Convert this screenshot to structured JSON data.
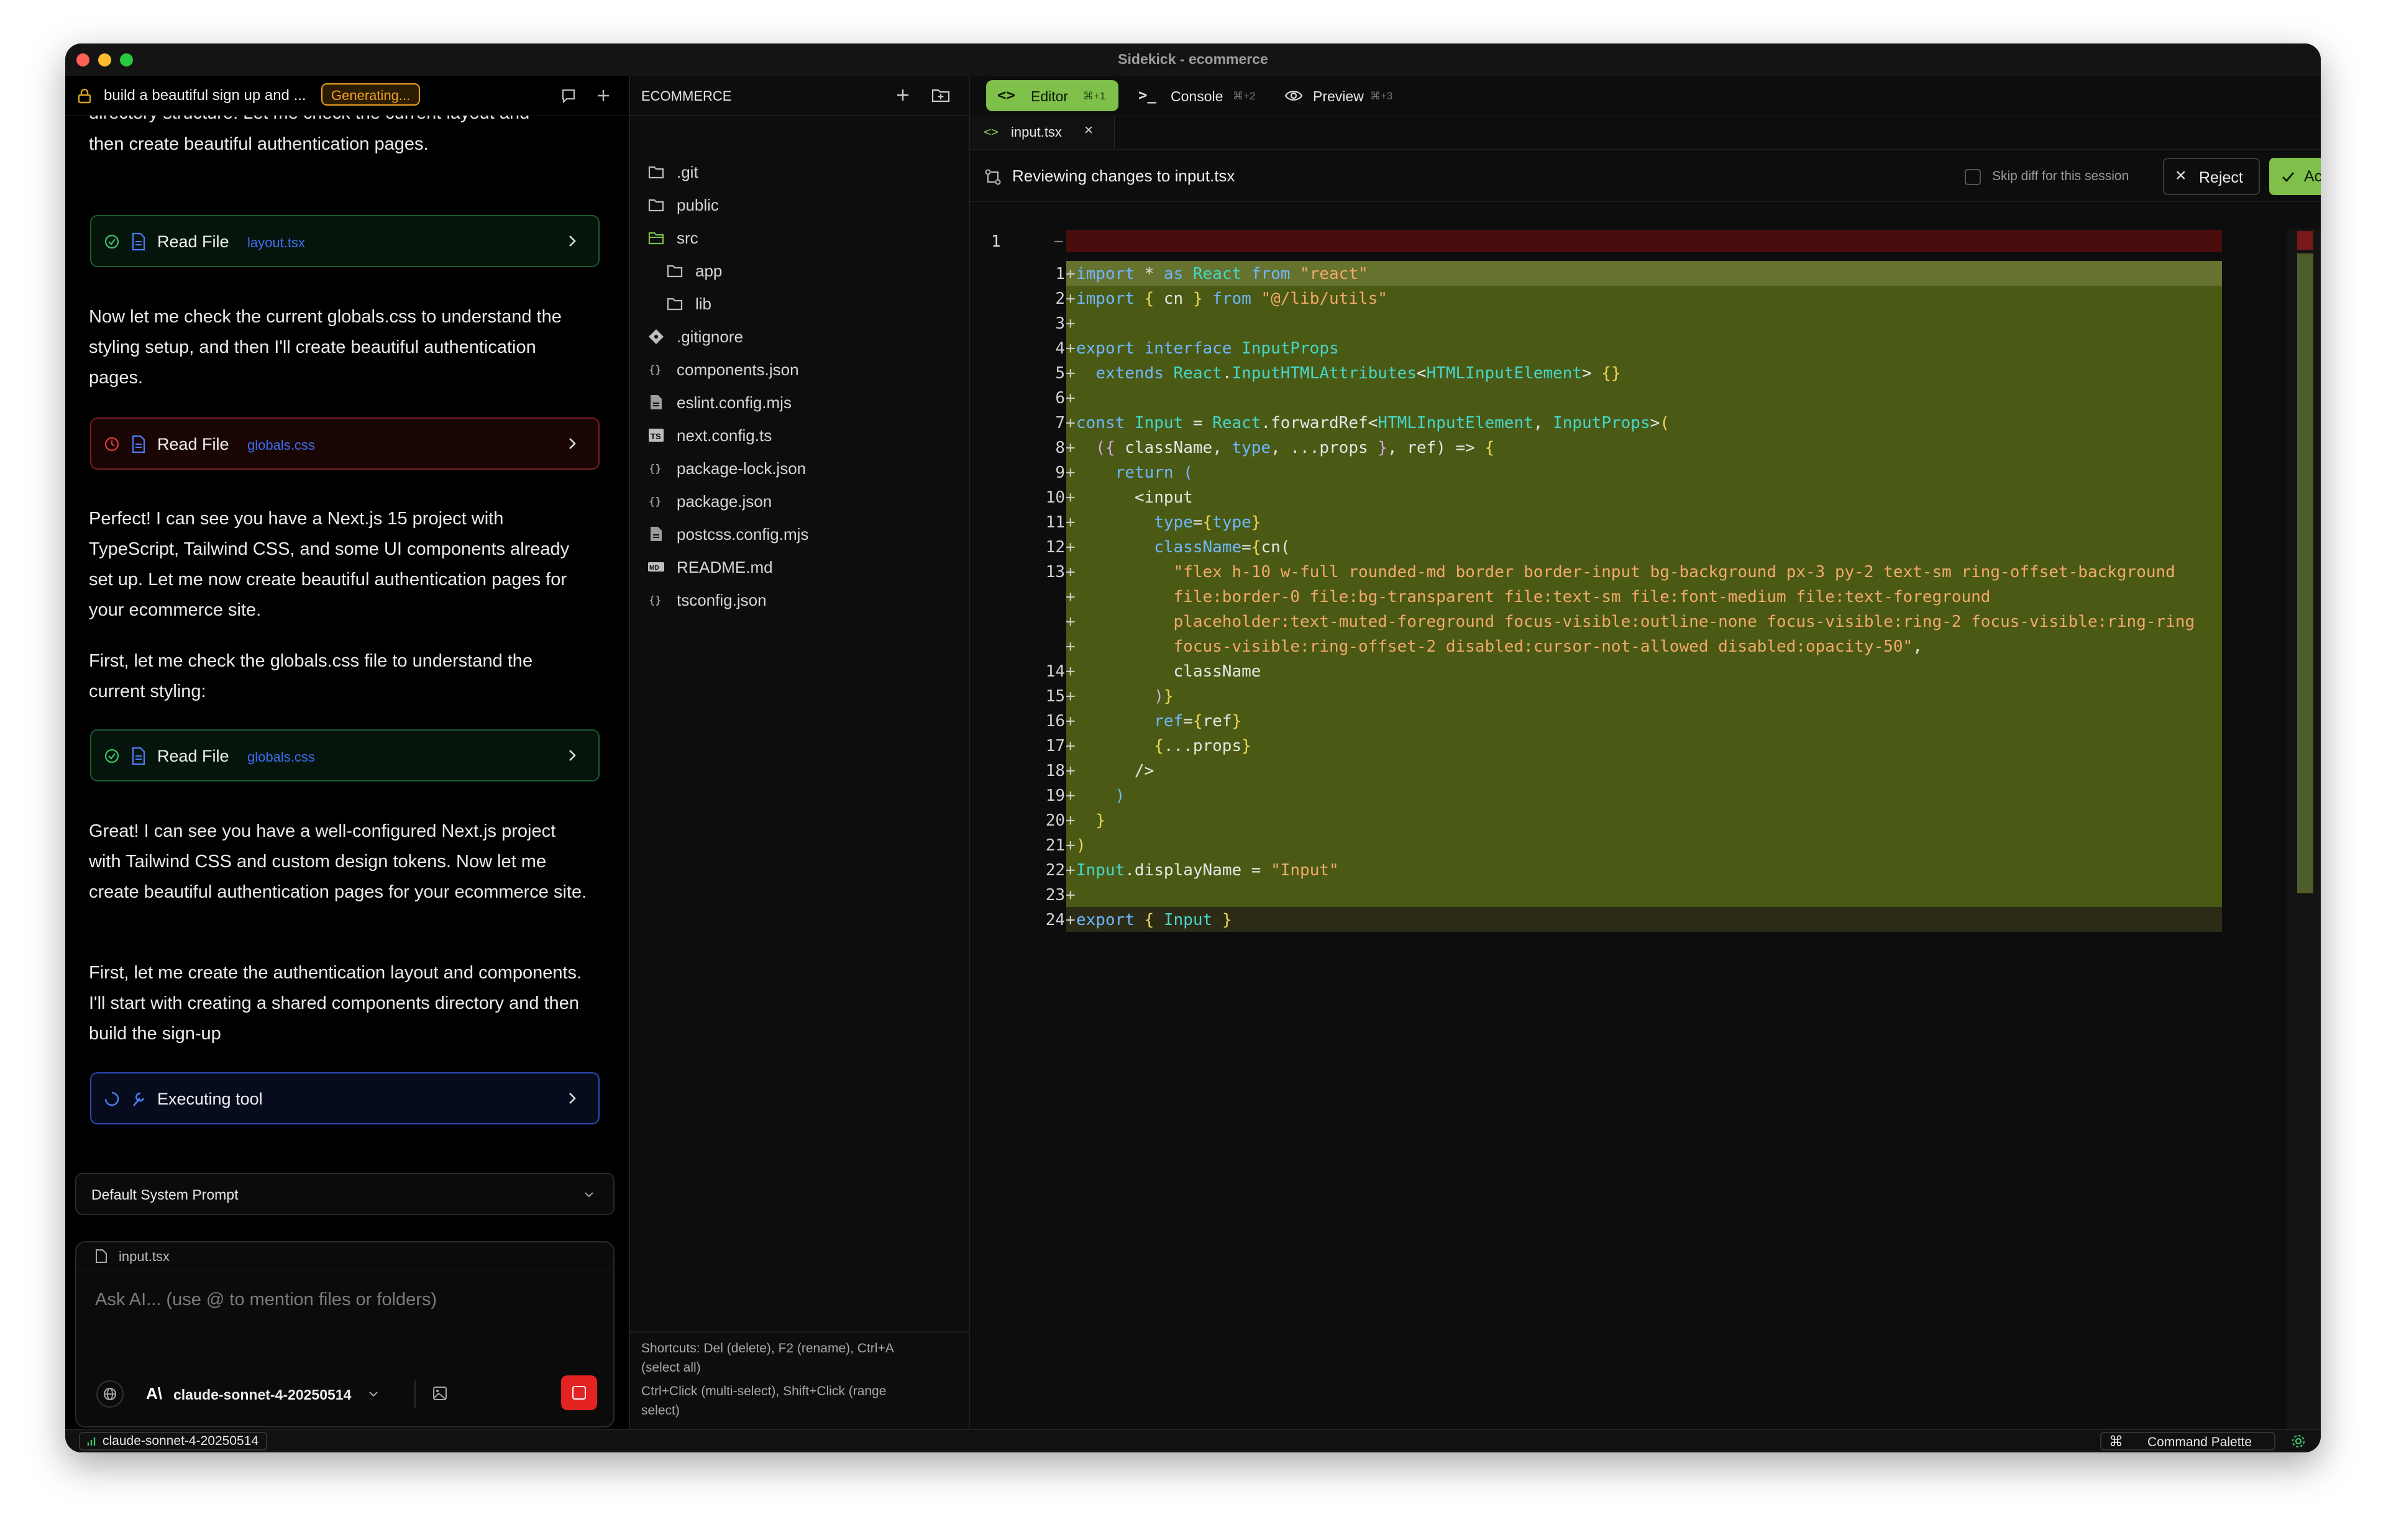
{
  "window": {
    "title": "Sidekick - ecommerce"
  },
  "chat": {
    "thread_title": "build a beautiful sign up and ...",
    "status_badge": "Generating...",
    "cut_off_text": "directory structure. Let me check the current layout and",
    "messages": [
      {
        "text": "then create beautiful authentication pages."
      },
      {
        "text": "Now let me check the current globals.css to understand the styling setup, and then I'll create beautiful authentication pages."
      },
      {
        "text": "Perfect! I can see you have a Next.js 15 project with TypeScript, Tailwind CSS, and some UI components already set up. Let me now create beautiful authentication pages for your ecommerce site."
      },
      {
        "text": "First, let me check the globals.css file to understand the current styling:"
      },
      {
        "text": "Great! I can see you have a well-configured Next.js project with Tailwind CSS and custom design tokens. Now let me create beautiful authentication pages for your ecommerce site."
      },
      {
        "text": "First, let me create the authentication layout and components. I'll start with creating a shared components directory and then build the sign-up"
      }
    ],
    "tools": [
      {
        "label": "Read File",
        "file": "layout.tsx",
        "status": "success"
      },
      {
        "label": "Read File",
        "file": "globals.css",
        "status": "error"
      },
      {
        "label": "Read File",
        "file": "globals.css",
        "status": "success"
      },
      {
        "label": "Executing tool",
        "file": "",
        "status": "running"
      }
    ],
    "system_prompt": "Default System Prompt",
    "context_file": "input.tsx",
    "input_placeholder": "Ask AI... (use @ to mention files or folders)",
    "model": "claude-sonnet-4-20250514"
  },
  "explorer": {
    "title": "ECOMMERCE",
    "items": [
      {
        "name": ".git",
        "icon": "folder-icon",
        "depth": 0
      },
      {
        "name": "public",
        "icon": "folder-icon",
        "depth": 0
      },
      {
        "name": "src",
        "icon": "folder-open-icon",
        "depth": 0
      },
      {
        "name": "app",
        "icon": "folder-icon",
        "depth": 1
      },
      {
        "name": "lib",
        "icon": "folder-icon",
        "depth": 1
      },
      {
        "name": ".gitignore",
        "icon": "git-icon",
        "depth": 0
      },
      {
        "name": "components.json",
        "icon": "json-icon",
        "depth": 0
      },
      {
        "name": "eslint.config.mjs",
        "icon": "file-icon",
        "depth": 0
      },
      {
        "name": "next.config.ts",
        "icon": "ts-icon",
        "depth": 0
      },
      {
        "name": "package-lock.json",
        "icon": "json-icon",
        "depth": 0
      },
      {
        "name": "package.json",
        "icon": "json-icon",
        "depth": 0
      },
      {
        "name": "postcss.config.mjs",
        "icon": "file-icon",
        "depth": 0
      },
      {
        "name": "README.md",
        "icon": "markdown-icon",
        "depth": 0
      },
      {
        "name": "tsconfig.json",
        "icon": "json-icon",
        "depth": 0
      }
    ],
    "shortcuts_1": "Shortcuts: Del (delete), F2 (rename), Ctrl+A",
    "shortcuts_2": "(select all)",
    "shortcuts_3": "Ctrl+Click (multi-select), Shift+Click (range",
    "shortcuts_4": "select)"
  },
  "editor": {
    "tabs": [
      {
        "label": "Editor",
        "shortcut": "⌘+1"
      },
      {
        "label": "Console",
        "shortcut": "⌘+2"
      },
      {
        "label": "Preview",
        "shortcut": "⌘+3"
      }
    ],
    "file_tab": "input.tsx",
    "review_text": "Reviewing changes to input.tsx",
    "skip_label": "Skip diff for this session",
    "reject_label": "Reject",
    "accept_label": "Accept",
    "removed_line": {
      "num": "1",
      "marker": "−"
    },
    "lines": [
      {
        "n": "1",
        "segs": [
          [
            "k",
            "import"
          ],
          [
            "f",
            " * "
          ],
          [
            "k",
            "as"
          ],
          [
            "t",
            " React "
          ],
          [
            "k",
            "from"
          ],
          [
            "s",
            " \"react\""
          ]
        ]
      },
      {
        "n": "2",
        "segs": [
          [
            "k",
            "import"
          ],
          [
            "y",
            " { "
          ],
          [
            "f",
            "cn"
          ],
          [
            "y",
            " } "
          ],
          [
            "k",
            "from"
          ],
          [
            "s",
            " \"@/lib/utils\""
          ]
        ]
      },
      {
        "n": "3",
        "segs": []
      },
      {
        "n": "4",
        "segs": [
          [
            "k",
            "export interface "
          ],
          [
            "t",
            "InputProps"
          ]
        ]
      },
      {
        "n": "5",
        "segs": [
          [
            "f",
            "  "
          ],
          [
            "k",
            "extends "
          ],
          [
            "t",
            "React"
          ],
          [
            "f",
            "."
          ],
          [
            "t",
            "InputHTMLAttributes"
          ],
          [
            "f",
            "<"
          ],
          [
            "t",
            "HTMLInputElement"
          ],
          [
            "f",
            "> "
          ],
          [
            "y",
            "{}"
          ]
        ]
      },
      {
        "n": "6",
        "segs": []
      },
      {
        "n": "7",
        "segs": [
          [
            "k",
            "const "
          ],
          [
            "t",
            "Input"
          ],
          [
            "f",
            " = "
          ],
          [
            "t",
            "React"
          ],
          [
            "f",
            ".forwardRef<"
          ],
          [
            "t",
            "HTMLInputElement"
          ],
          [
            "f",
            ", "
          ],
          [
            "t",
            "InputProps"
          ],
          [
            "f",
            ">"
          ],
          [
            "y",
            "("
          ]
        ]
      },
      {
        "n": "8",
        "segs": [
          [
            "p",
            "  ({ "
          ],
          [
            "f",
            "className, "
          ],
          [
            "k",
            "type"
          ],
          [
            "f",
            ", ...props "
          ],
          [
            "p",
            "}"
          ],
          [
            "f",
            ", ref) => "
          ],
          [
            "y",
            "{"
          ]
        ]
      },
      {
        "n": "9",
        "segs": [
          [
            "f",
            "    "
          ],
          [
            "k",
            "return ("
          ]
        ]
      },
      {
        "n": "10",
        "segs": [
          [
            "f",
            "      <input"
          ]
        ]
      },
      {
        "n": "11",
        "segs": [
          [
            "f",
            "        "
          ],
          [
            "k",
            "type"
          ],
          [
            "f",
            "="
          ],
          [
            "y",
            "{"
          ],
          [
            "k",
            "type"
          ],
          [
            "y",
            "}"
          ]
        ]
      },
      {
        "n": "12",
        "segs": [
          [
            "f",
            "        "
          ],
          [
            "k",
            "className"
          ],
          [
            "f",
            "="
          ],
          [
            "y",
            "{"
          ],
          [
            "f",
            "cn("
          ]
        ]
      },
      {
        "n": "13",
        "segs": [
          [
            "s",
            "          \"flex h-10 w-full rounded-md border border-input bg-background px-3 py-2 text-sm ring-offset-background"
          ]
        ]
      },
      {
        "n": "",
        "segs": [
          [
            "s",
            "          file:border-0 file:bg-transparent file:text-sm file:font-medium file:text-foreground"
          ]
        ]
      },
      {
        "n": "",
        "segs": [
          [
            "s",
            "          placeholder:text-muted-foreground focus-visible:outline-none focus-visible:ring-2 focus-visible:ring-ring"
          ]
        ]
      },
      {
        "n": "",
        "segs": [
          [
            "s",
            "          focus-visible:ring-offset-2 disabled:cursor-not-allowed disabled:opacity-50\""
          ],
          [
            "f",
            ","
          ]
        ]
      },
      {
        "n": "14",
        "segs": [
          [
            "f",
            "          className"
          ]
        ]
      },
      {
        "n": "15",
        "segs": [
          [
            "f",
            "        "
          ],
          [
            "p",
            ")"
          ],
          [
            "y",
            "}"
          ]
        ]
      },
      {
        "n": "16",
        "segs": [
          [
            "f",
            "        "
          ],
          [
            "k",
            "ref"
          ],
          [
            "f",
            "="
          ],
          [
            "y",
            "{"
          ],
          [
            "f",
            "ref"
          ],
          [
            "y",
            "}"
          ]
        ]
      },
      {
        "n": "17",
        "segs": [
          [
            "f",
            "        "
          ],
          [
            "y",
            "{"
          ],
          [
            "f",
            "...props"
          ],
          [
            "y",
            "}"
          ]
        ]
      },
      {
        "n": "18",
        "segs": [
          [
            "f",
            "      />"
          ]
        ]
      },
      {
        "n": "19",
        "segs": [
          [
            "f",
            "    "
          ],
          [
            "k",
            ")"
          ]
        ]
      },
      {
        "n": "20",
        "segs": [
          [
            "f",
            "  "
          ],
          [
            "y",
            "}"
          ]
        ]
      },
      {
        "n": "21",
        "segs": [
          [
            "y",
            ")"
          ]
        ]
      },
      {
        "n": "22",
        "segs": [
          [
            "t",
            "Input"
          ],
          [
            "f",
            ".displayName = "
          ],
          [
            "s",
            "\"Input\""
          ]
        ]
      },
      {
        "n": "23",
        "segs": []
      },
      {
        "n": "24",
        "segs": [
          [
            "k",
            "export "
          ],
          [
            "y",
            "{ "
          ],
          [
            "t",
            "Input "
          ],
          [
            "y",
            "}"
          ]
        ]
      }
    ]
  },
  "statusbar": {
    "model": "claude-sonnet-4-20250514",
    "command_palette": "Command Palette"
  },
  "colors": {
    "accent_green": "#7ec04a",
    "added_bg": "#4a5a14",
    "removed_bg": "#4a0d0d",
    "error_red": "#e23b3b",
    "badge_orange": "#f0a020",
    "link_blue": "#3d6ef0"
  }
}
